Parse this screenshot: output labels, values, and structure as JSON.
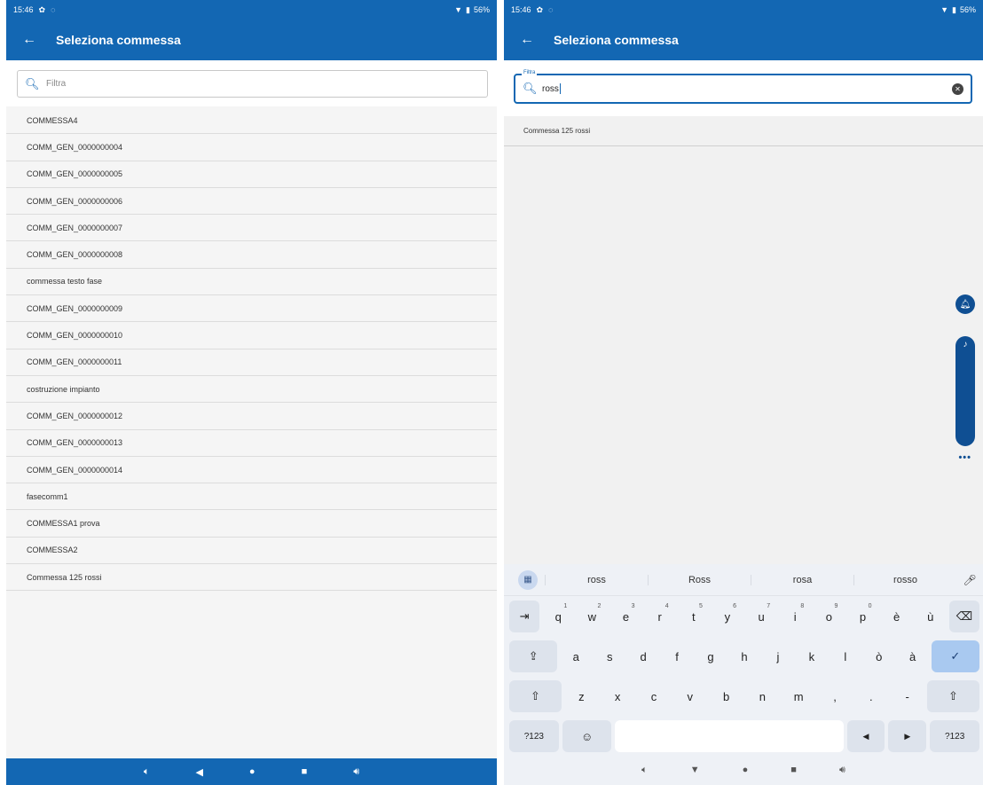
{
  "left": {
    "status": {
      "time": "15:46",
      "battery": "56%"
    },
    "header": {
      "title": "Seleziona commessa"
    },
    "search": {
      "placeholder": "Filtra"
    },
    "items": [
      "COMMESSA4",
      "COMM_GEN_0000000004",
      "COMM_GEN_0000000005",
      "COMM_GEN_0000000006",
      "COMM_GEN_0000000007",
      "COMM_GEN_0000000008",
      "commessa testo fase",
      "COMM_GEN_0000000009",
      "COMM_GEN_0000000010",
      "COMM_GEN_0000000011",
      "costruzione impianto",
      "COMM_GEN_0000000012",
      "COMM_GEN_0000000013",
      "COMM_GEN_0000000014",
      "fasecomm1",
      "COMMESSA1  prova",
      "COMMESSA2",
      "Commessa 125 rossi"
    ]
  },
  "right": {
    "status": {
      "time": "15:46",
      "battery": "56%"
    },
    "header": {
      "title": "Seleziona commessa"
    },
    "search": {
      "label": "Filtra",
      "value": "ross"
    },
    "results": [
      "Commessa 125 rossi"
    ],
    "keyboard": {
      "suggestions": [
        "ross",
        "Ross",
        "rosa",
        "rosso"
      ],
      "row1": [
        "q",
        "w",
        "e",
        "r",
        "t",
        "y",
        "u",
        "i",
        "o",
        "p",
        "è",
        "ù"
      ],
      "row1_hints": [
        "1",
        "2",
        "3",
        "4",
        "5",
        "6",
        "7",
        "8",
        "9",
        "0",
        "",
        ""
      ],
      "row2": [
        "a",
        "s",
        "d",
        "f",
        "g",
        "h",
        "j",
        "k",
        "l",
        "ò",
        "à"
      ],
      "row3": [
        "z",
        "x",
        "c",
        "v",
        "b",
        "n",
        "m",
        ",",
        ".",
        "-"
      ],
      "symbols_label": "?123"
    }
  },
  "colors": {
    "primary": "#1367b3",
    "dark": "#0f4f93",
    "accent_key": "#a9c9f0"
  }
}
